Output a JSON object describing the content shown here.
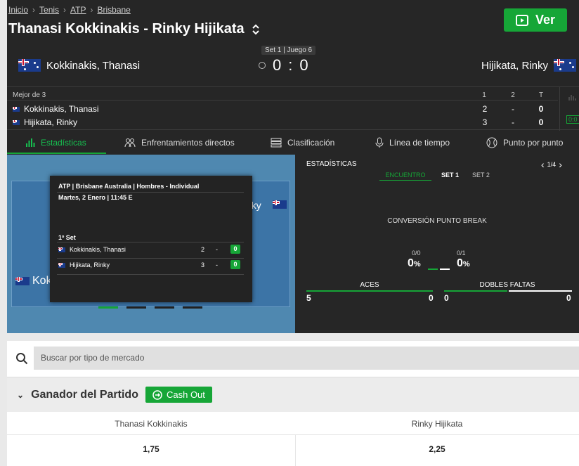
{
  "breadcrumb": [
    "Inicio",
    "Tenis",
    "ATP",
    "Brisbane"
  ],
  "match_title": "Thanasi Kokkinakis - Rinky Hijikata",
  "watch_button": "Ver",
  "set_badge": "Set 1 | Juego 6",
  "player1": {
    "name": "Kokkinakis, Thanasi",
    "short": "Kokkinakis, Thanasi"
  },
  "player2": {
    "name": "Hijikata, Rinky"
  },
  "game_score": {
    "p1": "0",
    "sep": ":",
    "p2": "0"
  },
  "scoreboard": {
    "format": "Mejor de 3",
    "headers": [
      "1",
      "2",
      "T"
    ],
    "rows": [
      {
        "name": "Kokkinakis, Thanasi",
        "s1": "2",
        "s2": "-",
        "t": "0"
      },
      {
        "name": "Hijikata, Rinky",
        "s1": "3",
        "s2": "-",
        "t": "0"
      }
    ],
    "badge": "0:0"
  },
  "tabs": [
    "Estadísticas",
    "Enfrentamientos directos",
    "Clasificación",
    "Línea de tiempo",
    "Punto por punto"
  ],
  "court": {
    "p1_label": "Kok",
    "p2_label": "nky"
  },
  "popup": {
    "tournament": "ATP | Brisbane Australia | Hombres - Individual",
    "date": "Martes, 2 Enero | 11:45 E",
    "set_label": "1º Set",
    "rows": [
      {
        "name": "Kokkinakis, Thanasi",
        "games": "2",
        "dash": "-",
        "points": "0"
      },
      {
        "name": "Hijikata, Rinky",
        "games": "3",
        "dash": "-",
        "points": "0"
      }
    ]
  },
  "stats": {
    "title": "ESTADÍSTICAS",
    "pager": "1/4",
    "subtabs": [
      "ENCUENTRO",
      "SET 1",
      "SET 2"
    ],
    "break_title": "CONVERSIÓN PUNTO BREAK",
    "break_left": {
      "ratio": "0/0",
      "pct": "0",
      "unit": "%"
    },
    "break_right": {
      "ratio": "0/1",
      "pct": "0",
      "unit": "%"
    },
    "aces": {
      "label": "ACES",
      "left": "5",
      "right": "0"
    },
    "dobles": {
      "label": "DOBLES FALTAS",
      "left": "0",
      "right": "0"
    }
  },
  "search": {
    "placeholder": "Buscar por tipo de mercado"
  },
  "market": {
    "title": "Ganador del Partido",
    "cashout": "Cash Out",
    "outcomes": [
      {
        "name": "Thanasi Kokkinakis",
        "odds": "1,75"
      },
      {
        "name": "Rinky Hijikata",
        "odds": "2,25"
      }
    ]
  },
  "colors": {
    "accent": "#16a637",
    "background": "#262626"
  }
}
